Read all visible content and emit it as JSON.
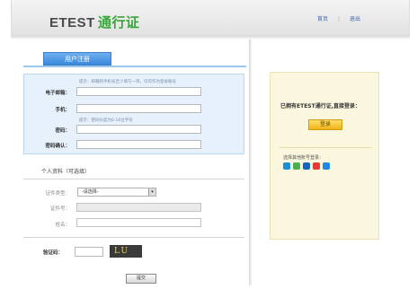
{
  "header": {
    "logo_latin": "ETEST",
    "logo_cn": "通行证",
    "links": [
      "首页",
      "退出"
    ]
  },
  "tab": {
    "label": "用户注册"
  },
  "form": {
    "email": {
      "hint": "提示：邮箱和手机号至少填写一项，均可作为登录账号",
      "label": "电子邮箱："
    },
    "phone": {
      "label": "手机："
    },
    "password": {
      "hint": "提示：密码长度为6-16位字符",
      "label": "密码："
    },
    "confirm": {
      "label": "密码确认："
    }
  },
  "personal": {
    "title": "个人资料（可选填）",
    "id_type": {
      "label": "证件类型：",
      "selected": "-请选择-"
    },
    "id_number": {
      "label": "证件号："
    },
    "name": {
      "label": "姓名："
    }
  },
  "captcha": {
    "label": "验证码：",
    "image_text": "LU"
  },
  "submit": {
    "label": "提交"
  },
  "login_box": {
    "title": "已拥有ETEST通行证,直接登录：",
    "button": "登录",
    "other_label": "选择其他账号登录："
  },
  "colors": {
    "logo_green": "#3aa53a",
    "tab_blue": "#3a88dc",
    "login_yellow": "#f0b418"
  },
  "third_party_icons": [
    "qq-icon",
    "weixin-icon",
    "alipay-icon",
    "weibo-icon",
    "renren-icon"
  ]
}
